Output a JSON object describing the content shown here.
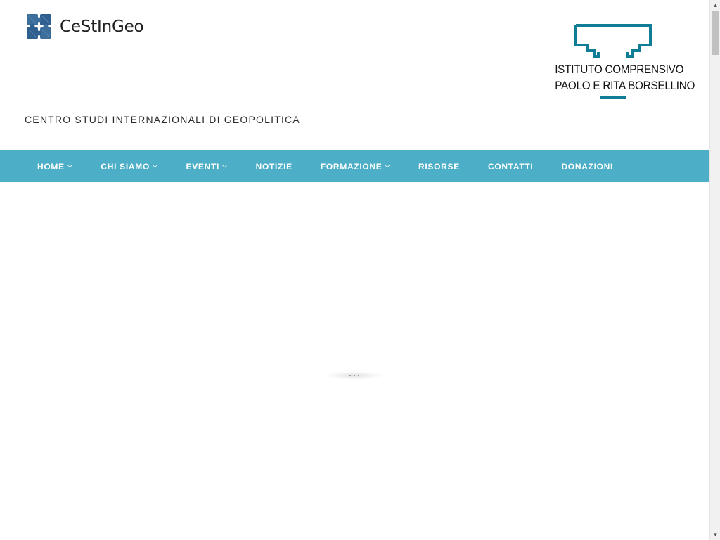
{
  "header": {
    "site_name": "CeStInGeo",
    "tagline": "CENTRO STUDI INTERNAZIONALI DI GEOPOLITICA",
    "partner_line1": "ISTITUTO COMPRENSIVO",
    "partner_line2": "PAOLO E RITA BORSELLINO"
  },
  "nav": {
    "items": [
      {
        "label": "HOME",
        "chevron": "⌵"
      },
      {
        "label": "CHI SIAMO",
        "chevron": "⌵"
      },
      {
        "label": "EVENTI",
        "chevron": "⌵"
      },
      {
        "label": "NOTIZIE"
      },
      {
        "label": "FORMAZIONE",
        "chevron": "⌵"
      },
      {
        "label": "RISORSE"
      },
      {
        "label": "CONTATTI"
      },
      {
        "label": "DONAZIONI"
      }
    ]
  },
  "icons": {
    "site_logo": "puzzle-logo-icon",
    "partner_logo": "school-emblem-icon",
    "nav_dropdown": "chevron-down-icon",
    "scroll_up": "arrow-up-icon",
    "scroll_down": "arrow-down-icon"
  },
  "colors": {
    "nav_background": "#4daec8",
    "logo_blue": "#2f5f8e",
    "partner_teal": "#0e7d95"
  },
  "scrollbar": {
    "up_glyph": "▲",
    "down_glyph": "▼"
  }
}
